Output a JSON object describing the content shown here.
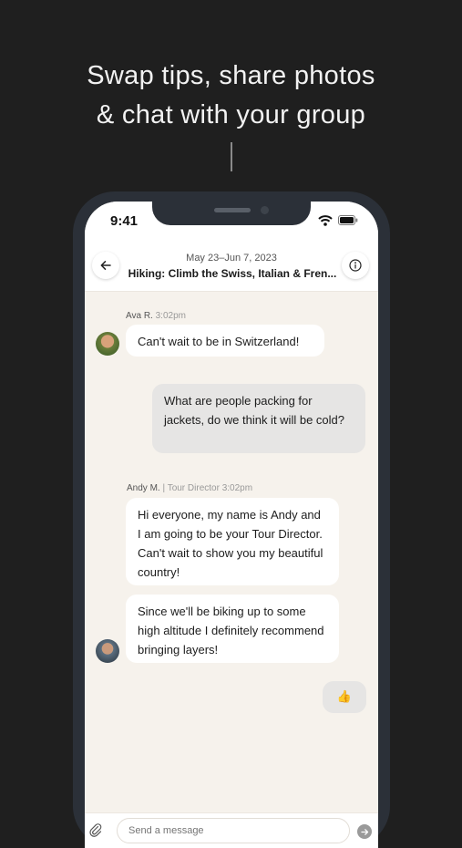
{
  "headline": {
    "line1": "Swap tips, share photos",
    "line2": "& chat with your group"
  },
  "status_bar": {
    "time": "9:41"
  },
  "header": {
    "dates": "May 23–Jun 7, 2023",
    "title": "Hiking: Climb the Swiss, Italian & Fren..."
  },
  "messages": [
    {
      "sender": "Ava R.",
      "time": "3:02pm",
      "text": "Can't wait to be in Switzerland!"
    },
    {
      "mine": true,
      "text": "What are people packing for jackets, do we think it will be cold?"
    },
    {
      "sender": "Andy M.",
      "role": "Tour Director",
      "time": "3:02pm",
      "text": "Hi everyone, my name is Andy and I am going to be your Tour Director. Can't wait to show you my beautiful country!"
    },
    {
      "sender": "Andy M.",
      "text": "Since we'll be biking up to some high altitude I definitely recommend bringing layers!"
    },
    {
      "mine": true,
      "text": "👍"
    }
  ],
  "composer": {
    "placeholder": "Send a message"
  },
  "icons": {
    "back": "arrow-left-icon",
    "info": "info-icon",
    "attach": "paperclip-icon",
    "send": "send-icon",
    "wifi": "wifi-icon",
    "battery": "battery-icon"
  }
}
